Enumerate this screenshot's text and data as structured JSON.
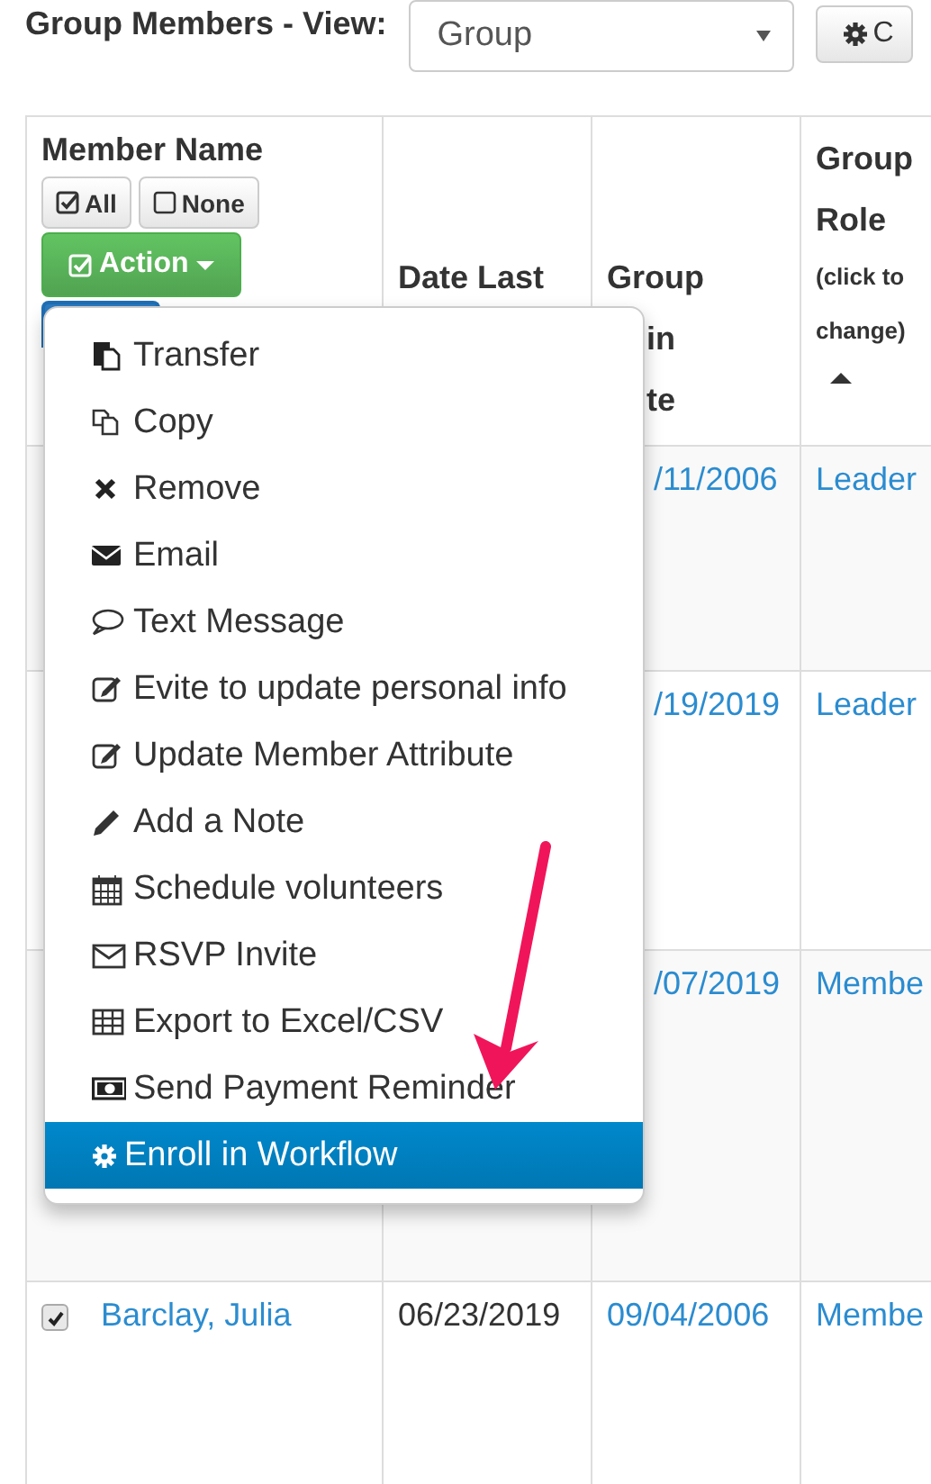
{
  "header": {
    "title": "Group Members - View:",
    "view_select": {
      "value": "Group"
    },
    "settings_button": {
      "label": "C"
    }
  },
  "table": {
    "member_header": {
      "title": "Member Name",
      "select_all": "All",
      "select_none": "None",
      "action": "Action"
    },
    "columns": [
      {
        "lines": [
          "Date Last"
        ]
      },
      {
        "lines": [
          "Group",
          "in",
          "te"
        ],
        "partial": [
          false,
          true,
          true
        ]
      },
      {
        "lines": [
          "Group",
          "Role"
        ],
        "note": "(click to change)",
        "sorted": true
      }
    ],
    "rows": [
      {
        "join_date": "/11/2006",
        "role": "Leader"
      },
      {
        "join_date": "/19/2019",
        "role": "Leader"
      },
      {
        "join_date": "/07/2019",
        "role": "Membe"
      },
      {
        "checked": true,
        "name": "Barclay, Julia",
        "last_date": "06/23/2019",
        "join_date": "09/04/2006",
        "role": "Membe"
      }
    ]
  },
  "action_menu": {
    "items": [
      {
        "label": "Transfer",
        "selected": false
      },
      {
        "label": "Copy",
        "selected": false
      },
      {
        "label": "Remove",
        "selected": false
      },
      {
        "label": "Email",
        "selected": false
      },
      {
        "label": "Text Message",
        "selected": false
      },
      {
        "label": "Evite to update personal info",
        "selected": false
      },
      {
        "label": "Update Member Attribute",
        "selected": false
      },
      {
        "label": "Add a Note",
        "selected": false
      },
      {
        "label": "Schedule volunteers",
        "selected": false
      },
      {
        "label": "RSVP Invite",
        "selected": false
      },
      {
        "label": "Export to Excel/CSV",
        "selected": false
      },
      {
        "label": "Send Payment Reminder",
        "selected": false
      },
      {
        "label": "Enroll in Workflow",
        "selected": true
      }
    ]
  },
  "annotation": {
    "kind": "arrow"
  }
}
